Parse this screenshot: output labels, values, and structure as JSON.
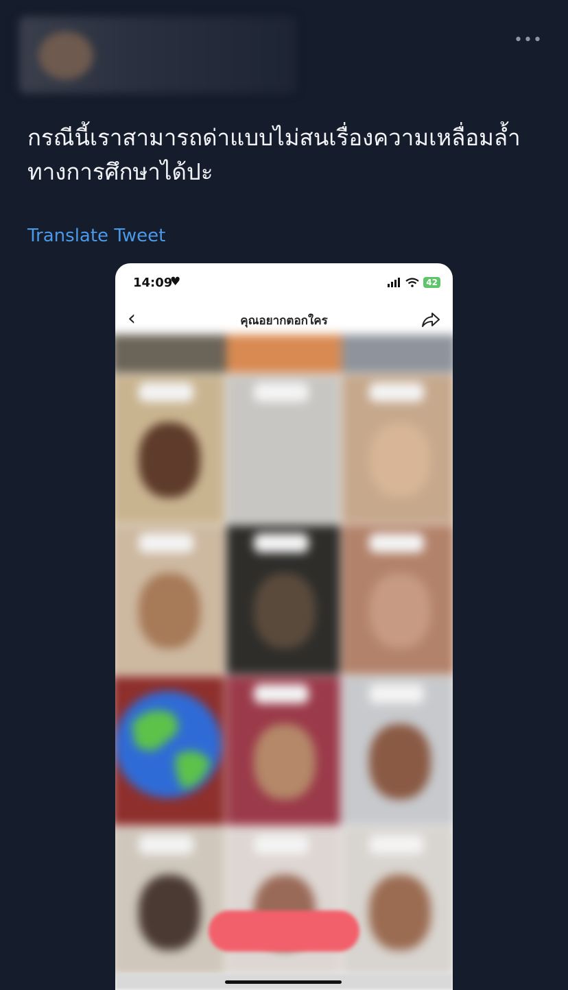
{
  "tweet": {
    "more_icon": "•••",
    "text_line1": "กรณีนี้เราสามารถด่าแบบไม่สนเรื่องความเหลื่อมล้ำ",
    "text_line2": "ทางการศึกษาได้ปะ",
    "translate_label": "Translate Tweet"
  },
  "screenshot": {
    "status_time": "14:09",
    "battery": "42",
    "nav_title": "คุณอยากตอกใคร",
    "icons": [
      "heart-icon",
      "signal-icon",
      "wifi-icon",
      "battery-icon",
      "back-chevron-icon",
      "share-icon",
      "globe-image"
    ]
  },
  "colors": {
    "background": "#151c2b",
    "text": "#f1f3f7",
    "link": "#4a99e9",
    "record_button": "#f2606b"
  }
}
